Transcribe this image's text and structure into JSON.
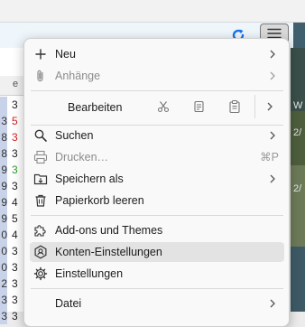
{
  "menu": {
    "items": [
      {
        "label": "Neu"
      },
      {
        "label": "Anhänge"
      },
      {
        "label": "Bearbeiten"
      },
      {
        "label": "Suchen"
      },
      {
        "label": "Drucken…",
        "shortcut": "⌘P"
      },
      {
        "label": "Speichern als"
      },
      {
        "label": "Papierkorb leeren"
      },
      {
        "label": "Add-ons und Themes"
      },
      {
        "label": "Konten-Einstellungen"
      },
      {
        "label": "Einstellungen"
      },
      {
        "label": "Datei"
      }
    ]
  },
  "background": {
    "column_header": "e",
    "rows": [
      {
        "c1": "",
        "c2": "3",
        "color": "#222222"
      },
      {
        "c1": "3",
        "c2": "5",
        "color": "#d42020"
      },
      {
        "c1": "8",
        "c2": "3",
        "color": "#d42020"
      },
      {
        "c1": "8",
        "c2": "3",
        "color": "#222222"
      },
      {
        "c1": "9",
        "c2": "3",
        "color": "#2e9a2e"
      },
      {
        "c1": "9",
        "c2": "3",
        "color": "#222222"
      },
      {
        "c1": "9",
        "c2": "4",
        "color": "#222222"
      },
      {
        "c1": "9",
        "c2": "5",
        "color": "#222222"
      },
      {
        "c1": "0",
        "c2": "4",
        "color": "#222222"
      },
      {
        "c1": "0",
        "c2": "3",
        "color": "#222222"
      },
      {
        "c1": "0",
        "c2": "3",
        "color": "#222222"
      },
      {
        "c1": "2",
        "c2": "3",
        "color": "#222222"
      },
      {
        "c1": "3",
        "c2": "3",
        "color": "#222222"
      },
      {
        "c1": "3",
        "c2": "3",
        "color": "#222222"
      }
    ],
    "right_strip_text": [
      "W",
      "2/",
      "2/"
    ]
  },
  "colors": {
    "accent": "#1a73e8",
    "hover": "#e3e3e3"
  }
}
